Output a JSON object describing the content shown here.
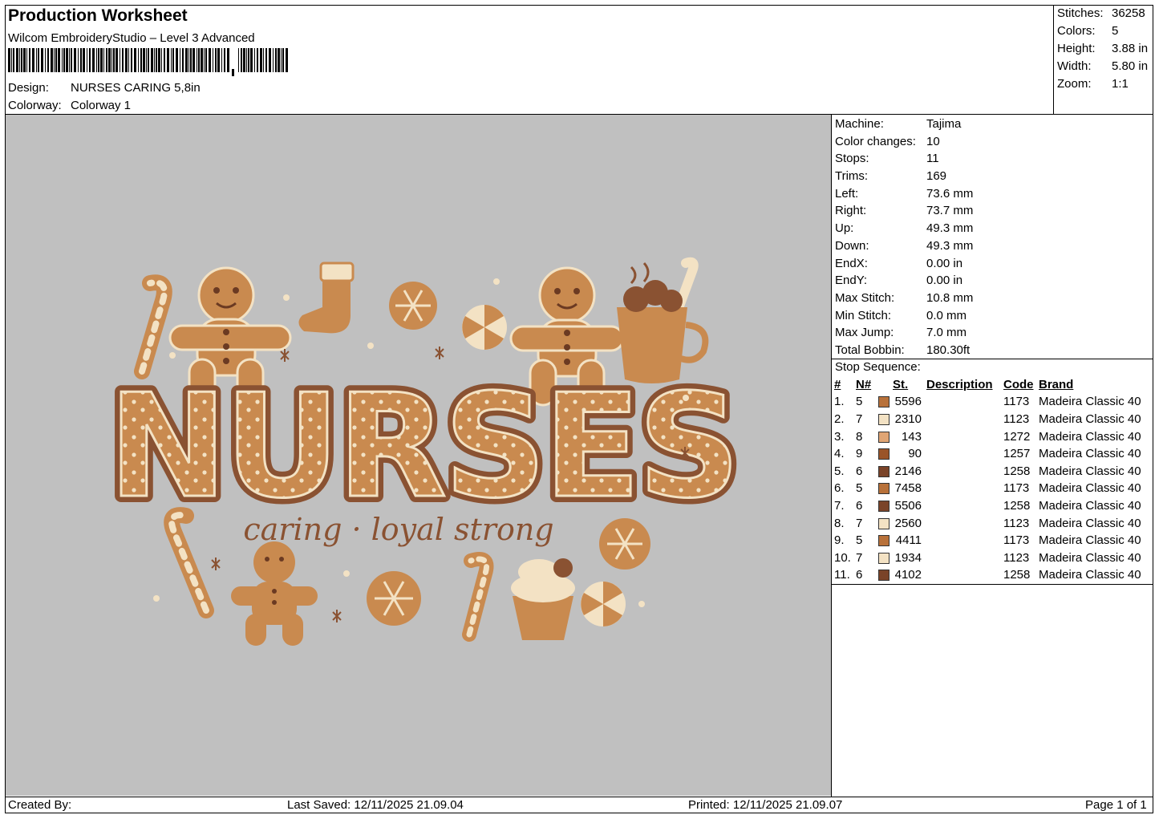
{
  "header": {
    "title": "Production Worksheet",
    "software": "Wilcom EmbroideryStudio – Level 3 Advanced",
    "design_label": "Design:",
    "design_value": "NURSES CARING 5,8in",
    "colorway_label": "Colorway:",
    "colorway_value": "Colorway 1"
  },
  "stats": [
    {
      "label": "Stitches:",
      "value": "36258"
    },
    {
      "label": "Colors:",
      "value": "5"
    },
    {
      "label": "Height:",
      "value": "3.88 in"
    },
    {
      "label": "Width:",
      "value": "5.80 in"
    },
    {
      "label": "Zoom:",
      "value": "1:1"
    }
  ],
  "machine": [
    {
      "label": "Machine:",
      "value": "Tajima"
    },
    {
      "label": "Color changes:",
      "value": "10"
    },
    {
      "label": "Stops:",
      "value": "11"
    },
    {
      "label": "Trims:",
      "value": "169"
    },
    {
      "label": "Left:",
      "value": "73.6 mm"
    },
    {
      "label": "Right:",
      "value": "73.7 mm"
    },
    {
      "label": "Up:",
      "value": "49.3 mm"
    },
    {
      "label": "Down:",
      "value": "49.3 mm"
    },
    {
      "label": "EndX:",
      "value": "0.00 in"
    },
    {
      "label": "EndY:",
      "value": "0.00 in"
    },
    {
      "label": "Max Stitch:",
      "value": "10.8 mm"
    },
    {
      "label": "Min Stitch:",
      "value": "0.0 mm"
    },
    {
      "label": "Max Jump:",
      "value": "7.0 mm"
    },
    {
      "label": "Total Bobbin:",
      "value": "180.30ft"
    }
  ],
  "stop_sequence": {
    "title": "Stop Sequence:",
    "headers": {
      "idx": "#",
      "n": "N#",
      "st": "St.",
      "description": "Description",
      "code": "Code",
      "brand": "Brand"
    },
    "rows": [
      {
        "idx": "1.",
        "n": "5",
        "color": "#b8713a",
        "st": "5596",
        "code": "1173",
        "brand": "Madeira Classic 40"
      },
      {
        "idx": "2.",
        "n": "7",
        "color": "#f3e2c4",
        "st": "2310",
        "code": "1123",
        "brand": "Madeira Classic 40"
      },
      {
        "idx": "3.",
        "n": "8",
        "color": "#e0a574",
        "st": "143",
        "code": "1272",
        "brand": "Madeira Classic 40"
      },
      {
        "idx": "4.",
        "n": "9",
        "color": "#9a5428",
        "st": "90",
        "code": "1257",
        "brand": "Madeira Classic 40"
      },
      {
        "idx": "5.",
        "n": "6",
        "color": "#7a4328",
        "st": "2146",
        "code": "1258",
        "brand": "Madeira Classic 40"
      },
      {
        "idx": "6.",
        "n": "5",
        "color": "#b8713a",
        "st": "7458",
        "code": "1173",
        "brand": "Madeira Classic 40"
      },
      {
        "idx": "7.",
        "n": "6",
        "color": "#7a4328",
        "st": "5506",
        "code": "1258",
        "brand": "Madeira Classic 40"
      },
      {
        "idx": "8.",
        "n": "7",
        "color": "#f3e2c4",
        "st": "2560",
        "code": "1123",
        "brand": "Madeira Classic 40"
      },
      {
        "idx": "9.",
        "n": "5",
        "color": "#b8713a",
        "st": "4411",
        "code": "1173",
        "brand": "Madeira Classic 40"
      },
      {
        "idx": "10.",
        "n": "7",
        "color": "#f3e2c4",
        "st": "1934",
        "code": "1123",
        "brand": "Madeira Classic 40"
      },
      {
        "idx": "11.",
        "n": "6",
        "color": "#7a4328",
        "st": "4102",
        "code": "1258",
        "brand": "Madeira Classic 40"
      }
    ]
  },
  "design_preview": {
    "main_text": "NURSES",
    "tagline": "caring · loyal  strong",
    "colors": {
      "cookie": "#c98a4f",
      "cookie_dark": "#8a5232",
      "icing": "#f3e2c4",
      "background": "#c0c0c0"
    }
  },
  "footer": {
    "created_by": "Created By:",
    "last_saved": "Last Saved: 12/11/2025 21.09.04",
    "printed": "Printed: 12/11/2025 21.09.07",
    "page": "Page 1 of 1"
  }
}
